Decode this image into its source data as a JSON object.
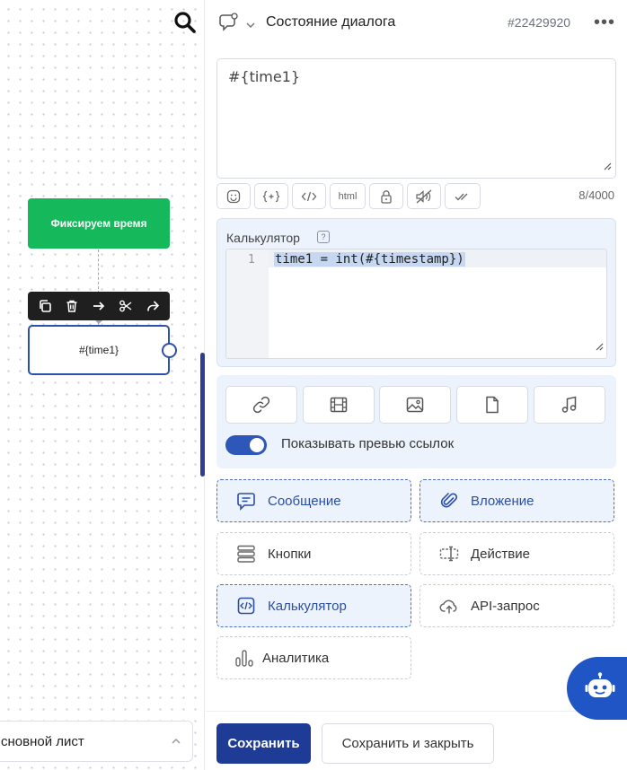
{
  "canvas": {
    "nodes": [
      {
        "label": "Фиксируем время",
        "color": "#16b85c"
      },
      {
        "label": "#{time1}"
      }
    ],
    "sheet_select": {
      "value": "сновной лист"
    }
  },
  "panel": {
    "header": {
      "title": "Состояние диалога",
      "id": "#22429920"
    },
    "message": {
      "text": "#{time1}",
      "char_count": "8/4000"
    },
    "format_toolbar": {
      "html_label": "html"
    },
    "calculator": {
      "label": "Калькулятор",
      "help": "?",
      "line_number": "1",
      "code": "time1 = int(#{timestamp})"
    },
    "attachments": {
      "preview_label": "Показывать превью ссылок",
      "preview_enabled": true
    },
    "blocks": [
      {
        "label": "Сообщение",
        "icon": "message-icon",
        "active": true
      },
      {
        "label": "Вложение",
        "icon": "paperclip-icon",
        "active": true
      },
      {
        "label": "Кнопки",
        "icon": "buttons-icon",
        "active": false
      },
      {
        "label": "Действие",
        "icon": "action-icon",
        "active": false
      },
      {
        "label": "Калькулятор",
        "icon": "code-icon",
        "active": true
      },
      {
        "label": "API-запрос",
        "icon": "cloud-upload-icon",
        "active": false
      },
      {
        "label": "Аналитика",
        "icon": "analytics-icon",
        "active": false
      }
    ],
    "footer": {
      "save": "Сохранить",
      "save_close": "Сохранить и закрыть"
    }
  },
  "colors": {
    "accent": "#1e3c96",
    "node_green": "#16b85c",
    "active_bg": "#edf3fc"
  }
}
